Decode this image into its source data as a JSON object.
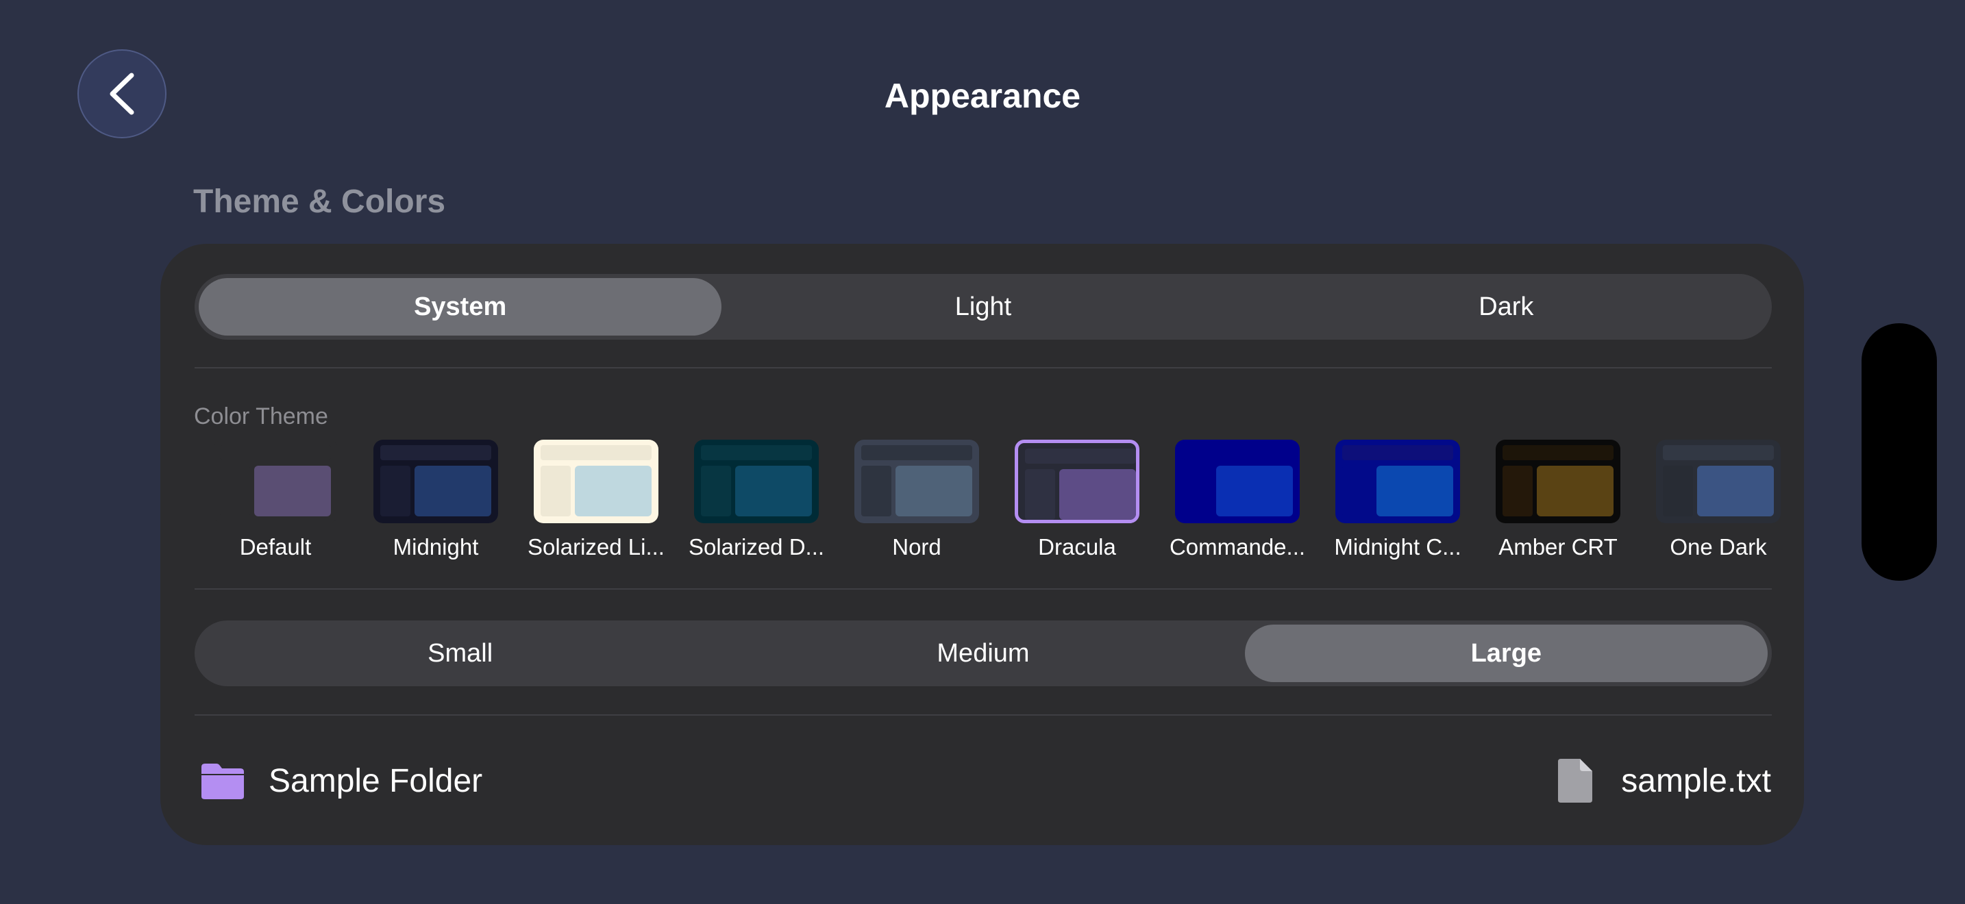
{
  "header": {
    "title": "Appearance",
    "back_icon": "chevron-left-icon"
  },
  "section": {
    "title": "Theme & Colors"
  },
  "appearance_mode": {
    "options": [
      "System",
      "Light",
      "Dark"
    ],
    "selected": "System"
  },
  "color_theme": {
    "label": "Color Theme",
    "selected": "Dracula",
    "themes": [
      {
        "name": "Default",
        "colors": {
          "bg": "#2c2c2e",
          "bar": "#2c2c2e",
          "side": "#2c2c2e",
          "main": "#5a4e73"
        }
      },
      {
        "name": "Midnight",
        "colors": {
          "bg": "#121426",
          "bar": "#1f2238",
          "side": "#1a1d33",
          "main": "#223a6b"
        }
      },
      {
        "name": "Solarized Li...",
        "colors": {
          "bg": "#fdf6e3",
          "bar": "#eee8d5",
          "side": "#eee8d5",
          "main": "#bfd8df"
        }
      },
      {
        "name": "Solarized D...",
        "colors": {
          "bg": "#002b36",
          "bar": "#073642",
          "side": "#073642",
          "main": "#0e4a66"
        }
      },
      {
        "name": "Nord",
        "colors": {
          "bg": "#3b4252",
          "bar": "#2e3440",
          "side": "#2e3440",
          "main": "#4f6278"
        }
      },
      {
        "name": "Dracula",
        "colors": {
          "bg": "#282a36",
          "bar": "#2f3142",
          "side": "#2f3142",
          "main": "#5d4c86"
        }
      },
      {
        "name": "Commande...",
        "colors": {
          "bg": "#00008b",
          "bar": "#00008b",
          "side": "#00008b",
          "main": "#0a2fb3"
        }
      },
      {
        "name": "Midnight C...",
        "colors": {
          "bg": "#020a8a",
          "bar": "#0d0f7a",
          "side": "#020a8a",
          "main": "#0b48b0"
        }
      },
      {
        "name": "Amber CRT",
        "colors": {
          "bg": "#0a0a0a",
          "bar": "#1d1509",
          "side": "#24180a",
          "main": "#5a4314"
        }
      },
      {
        "name": "One Dark",
        "colors": {
          "bg": "#2a2e37",
          "bar": "#323844",
          "side": "#282c34",
          "main": "#3b5483"
        }
      }
    ]
  },
  "font_size": {
    "options": [
      "Small",
      "Medium",
      "Large"
    ],
    "selected": "Large"
  },
  "preview": {
    "folder_label": "Sample Folder",
    "folder_icon": "folder-icon",
    "file_label": "sample.txt",
    "file_icon": "document-icon"
  },
  "colors": {
    "background": "#2c3145",
    "card": "#2c2c2e",
    "accent": "#b48ef2",
    "segment_selected": "#6d6e74"
  }
}
